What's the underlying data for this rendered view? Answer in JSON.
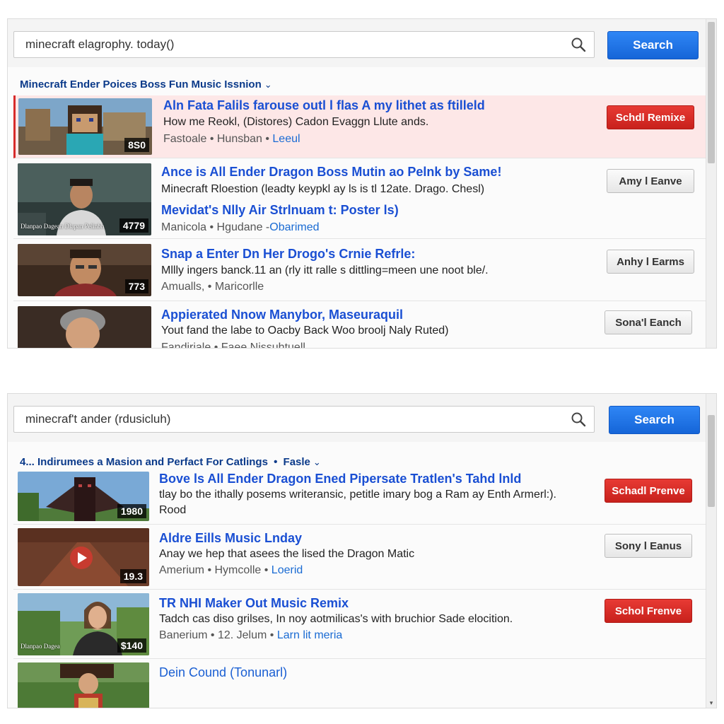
{
  "top": {
    "search_value": "minecraft elagrophy. today()",
    "search_button": "Search",
    "filter_label": "Minecraft Ender Poices Boss Fun Music Issnion",
    "results": [
      {
        "title": "Aln Fata Falils farouse outl l flas A my lithet as ftilleld",
        "desc": "How me Reokl, (Distores) Cadon Evaggn Llute ands.",
        "meta": "Fastoale • Hunsban •",
        "meta_link": "Leeul",
        "duration": "8S0",
        "action": "Schdl Remixe"
      },
      {
        "title": "Ance is All Ender Dragon Boss Mutin ao Pelnk by Same!",
        "desc": "Minecraft Rloestion (leadty keypkl ay ls is tl 12ate. Drago. Chesl)",
        "title2": "Mevidat's Nlly Air Strlnuam t: Poster ls)",
        "meta": "Manicola • Hgudane -",
        "meta_link": "Obarimed",
        "thumb_caption": "Dlanpao Dagean Dlapan Pelinbh",
        "duration": "4779",
        "action": "Amy l Eanve"
      },
      {
        "title": "Snap a Enter Dn Her Drogo's Crnie Refrle:",
        "desc": "Mllly ingers banck.11 an (rly itt ralle s dittling=meen une noot ble/.",
        "meta": "Amualls, • Maricorlle",
        "duration": "773",
        "action": "Anhy l Earms"
      },
      {
        "title": "Appierated Nnow Manybor, Maseuraquil",
        "desc": "Yout fand the labe to Oacby Back Woo broolj Naly Ruted)",
        "meta": "Fandiriale • Faee Nissuhtuell",
        "duration": "",
        "action": "Sona'l Eanch"
      }
    ]
  },
  "bottom": {
    "search_value": "minecraf't ander (rdusicluh)",
    "search_button": "Search",
    "filter_label": "4... Indirumees a Masion and Perfact For Catlings",
    "filter_extra": "Fasle",
    "results": [
      {
        "title": "Bove ls All Ender Dragon Ened Pipersate Tratlen's Tahd lnld",
        "desc": "tlay bo the ithally posems writeransic, petitle imary bog a Ram ay Enth Armerl:).",
        "desc2": "Rood",
        "duration": "1980",
        "action": "Schadl Prenve"
      },
      {
        "title": "Aldre Eills Music Lnday",
        "desc": "Anay we hep that asees the lised the Dragon Matic",
        "meta": "Amerium • Hymcolle •",
        "meta_link": "Loerid",
        "duration": "19.3",
        "action": "Sony l Eanus"
      },
      {
        "title": "TR NHI Maker Out Music Remix",
        "desc": "Tadch cas diso grilses, In noy aotmilicas's with bruchior Sade elocition.",
        "meta": "Banerium • 12. Jelum •",
        "meta_link": "Larn lit meria",
        "thumb_caption": "Dlanpao Dagea",
        "duration": "$140",
        "action": "Schol Frenve"
      },
      {
        "title": "Dein Cound (Tonunarl)"
      }
    ]
  },
  "colors": {
    "accent_blue": "#1a73e8",
    "title_blue": "#1a4fd3",
    "action_red": "#d72b2b",
    "highlight_row": "#fde7e7"
  },
  "icons": [
    "search-icon",
    "chevron-down-icon",
    "play-icon"
  ]
}
